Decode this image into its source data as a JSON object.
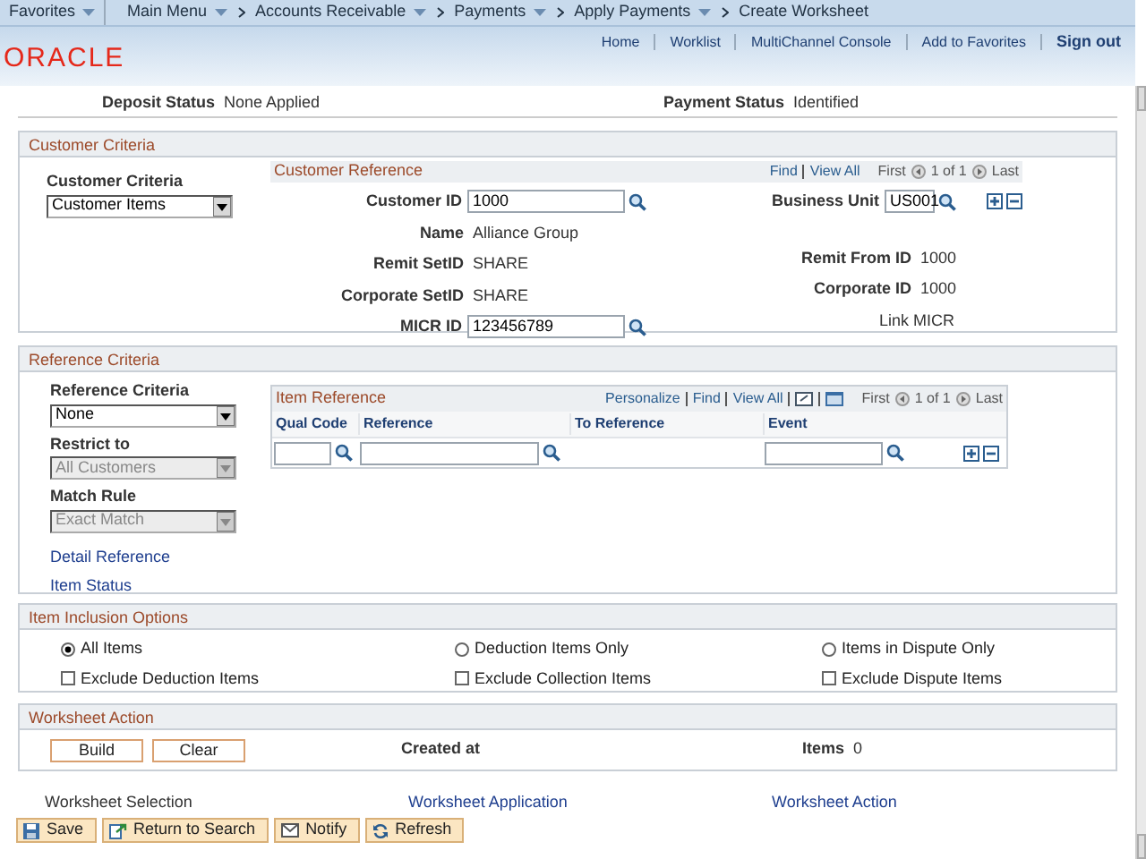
{
  "breadcrumbs": [
    {
      "label": "Favorites",
      "menu": true
    },
    {
      "label": "Main Menu",
      "menu": true
    },
    {
      "label": "Accounts Receivable",
      "menu": true
    },
    {
      "label": "Payments",
      "menu": true
    },
    {
      "label": "Apply Payments",
      "menu": true
    },
    {
      "label": "Create Worksheet",
      "menu": false
    }
  ],
  "header_links": [
    "Home",
    "Worklist",
    "MultiChannel Console",
    "Add to Favorites",
    "Sign out"
  ],
  "logo": "ORACLE",
  "summary": [
    {
      "label": "Deposit Status",
      "value": "None Applied"
    },
    {
      "label": "Payment Status",
      "value": "Identified"
    }
  ],
  "customer_criteria": {
    "title": "Customer Criteria",
    "criteria_label": "Customer Criteria",
    "criteria_value": "Customer Items",
    "reference": {
      "title": "Customer Reference",
      "find": "Find",
      "view_all": "View All",
      "first": "First",
      "count": "1 of 1",
      "last": "Last",
      "customer_id": {
        "label": "Customer ID",
        "value": "1000"
      },
      "business_unit": {
        "label": "Business Unit",
        "value": "US001"
      },
      "name": {
        "label": "Name",
        "value": "Alliance Group"
      },
      "remit_setid": {
        "label": "Remit SetID",
        "value": "SHARE"
      },
      "remit_from_id": {
        "label": "Remit From ID",
        "value": "1000"
      },
      "corporate_setid": {
        "label": "Corporate SetID",
        "value": "SHARE"
      },
      "corporate_id": {
        "label": "Corporate ID",
        "value": "1000"
      },
      "micr_id": {
        "label": "MICR ID",
        "value": "123456789"
      },
      "link_micr": "Link MICR"
    }
  },
  "reference_criteria": {
    "title": "Reference Criteria",
    "dropdowns": [
      {
        "label": "Reference Criteria",
        "value": "None",
        "disabled": false
      },
      {
        "label": "Restrict to",
        "value": "All Customers",
        "disabled": true
      },
      {
        "label": "Match Rule",
        "value": "Exact Match",
        "disabled": true
      }
    ],
    "links": [
      "Detail Reference",
      "Item Status"
    ],
    "item_reference": {
      "title": "Item Reference",
      "personalize": "Personalize",
      "find": "Find",
      "view_all": "View All",
      "first": "First",
      "count": "1 of 1",
      "last": "Last",
      "columns": [
        "Qual Code",
        "Reference",
        "To Reference",
        "Event"
      ]
    }
  },
  "inclusion": {
    "title": "Item Inclusion Options",
    "radios": [
      {
        "label": "All Items",
        "selected": true
      },
      {
        "label": "Deduction Items Only",
        "selected": false
      },
      {
        "label": "Items in Dispute Only",
        "selected": false
      }
    ],
    "checkboxes": [
      {
        "label": "Exclude Deduction Items",
        "checked": false
      },
      {
        "label": "Exclude Collection Items",
        "checked": false
      },
      {
        "label": "Exclude Dispute Items",
        "checked": false
      }
    ]
  },
  "worksheet_action": {
    "title": "Worksheet Action",
    "buttons": [
      "Build",
      "Clear"
    ],
    "created_label": "Created at",
    "items_label": "Items",
    "items_value": "0"
  },
  "page_tabs": [
    {
      "label": "Worksheet Selection",
      "selected": true
    },
    {
      "label": "Worksheet Application",
      "selected": false
    },
    {
      "label": "Worksheet Action",
      "selected": false
    }
  ],
  "toolbar": [
    {
      "label": "Save",
      "kind": "save"
    },
    {
      "label": "Return to Search",
      "kind": "return"
    },
    {
      "label": "Notify",
      "kind": "notify"
    },
    {
      "label": "Refresh",
      "kind": "refresh"
    }
  ]
}
